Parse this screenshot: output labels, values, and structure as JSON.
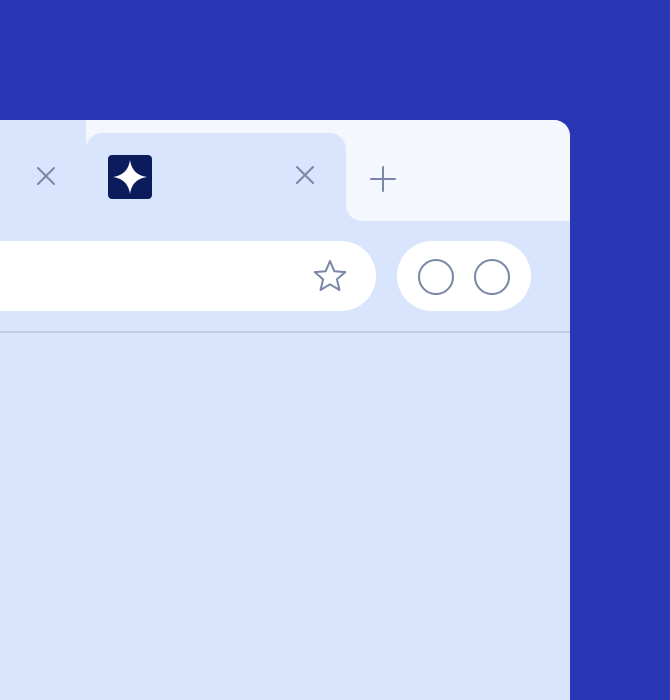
{
  "colors": {
    "background": "#2a37b5",
    "window": "#d8e5fd",
    "tabstrip": "#f4f8fe",
    "favicon": "#0c1b5c",
    "icon_stroke": "#7a86a8",
    "pill": "#ffffff",
    "divider": "#c2cbe0"
  },
  "tabs": [
    {
      "title": "",
      "active": false,
      "close_icon": "close-icon"
    },
    {
      "title": "",
      "active": true,
      "favicon": "sparkle-icon",
      "close_icon": "close-icon"
    }
  ],
  "new_tab": {
    "icon": "plus-icon"
  },
  "omnibox": {
    "value": "",
    "placeholder": "",
    "bookmark_icon": "star-icon"
  },
  "extensions": [
    {
      "icon": "circle-icon"
    },
    {
      "icon": "circle-icon"
    }
  ]
}
